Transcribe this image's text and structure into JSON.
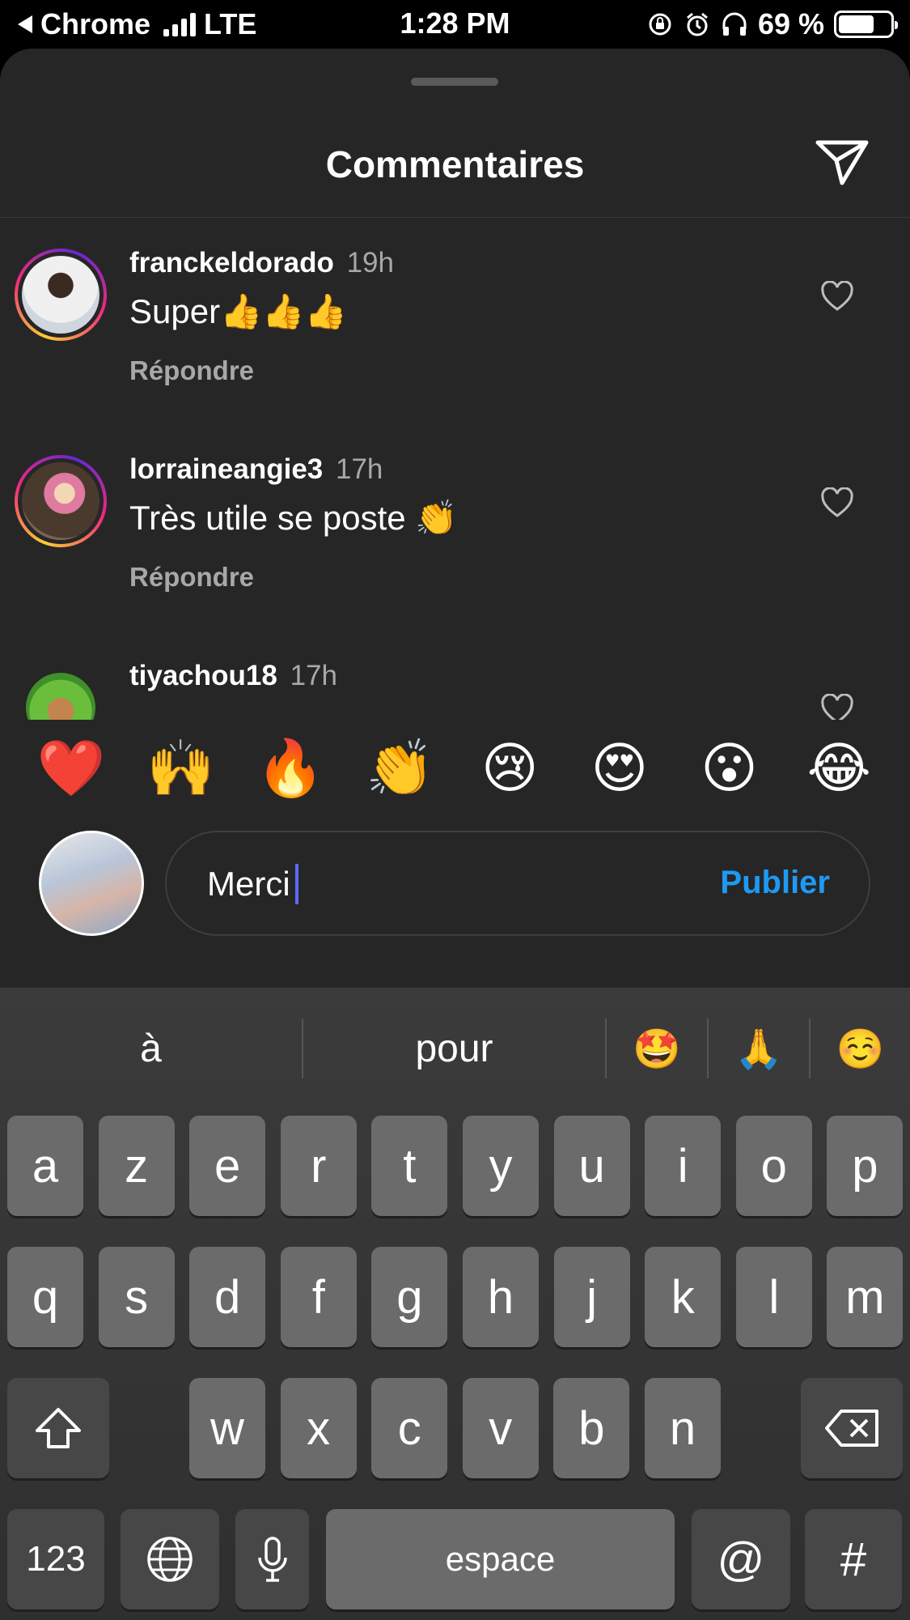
{
  "status_bar": {
    "back_app": "Chrome",
    "network": "LTE",
    "time": "1:28 PM",
    "battery_text": "69 %",
    "battery_level": 0.69
  },
  "sheet": {
    "title": "Commentaires",
    "send_icon": "paper-plane-icon"
  },
  "comments": [
    {
      "user": "franckeldorado",
      "time": "19h",
      "text": "Super👍👍👍",
      "reply": "Répondre",
      "avatar_color": "#dcdcdc"
    },
    {
      "user": "lorraineangie3",
      "time": "17h",
      "text": "Très utile se poste 👏",
      "reply": "Répondre",
      "avatar_color": "#8b6e5a"
    },
    {
      "user": "tiyachou18",
      "time": "17h",
      "text": "",
      "reply": "",
      "avatar_color": "#6bbd3c"
    }
  ],
  "reactions": [
    "❤️",
    "🙌",
    "🔥",
    "👏",
    "😢",
    "😍",
    "😮",
    "😂"
  ],
  "composer": {
    "value": "Merci",
    "publish_label": "Publier"
  },
  "keyboard": {
    "suggestions": [
      "à",
      "pour",
      "🤩",
      "🙏",
      "☺️"
    ],
    "row1": [
      "a",
      "z",
      "e",
      "r",
      "t",
      "y",
      "u",
      "i",
      "o",
      "p"
    ],
    "row2": [
      "q",
      "s",
      "d",
      "f",
      "g",
      "h",
      "j",
      "k",
      "l",
      "m"
    ],
    "row3": [
      "w",
      "x",
      "c",
      "v",
      "b",
      "n"
    ],
    "numbers_label": "123",
    "space_label": "espace",
    "at_label": "@",
    "hash_label": "#"
  }
}
